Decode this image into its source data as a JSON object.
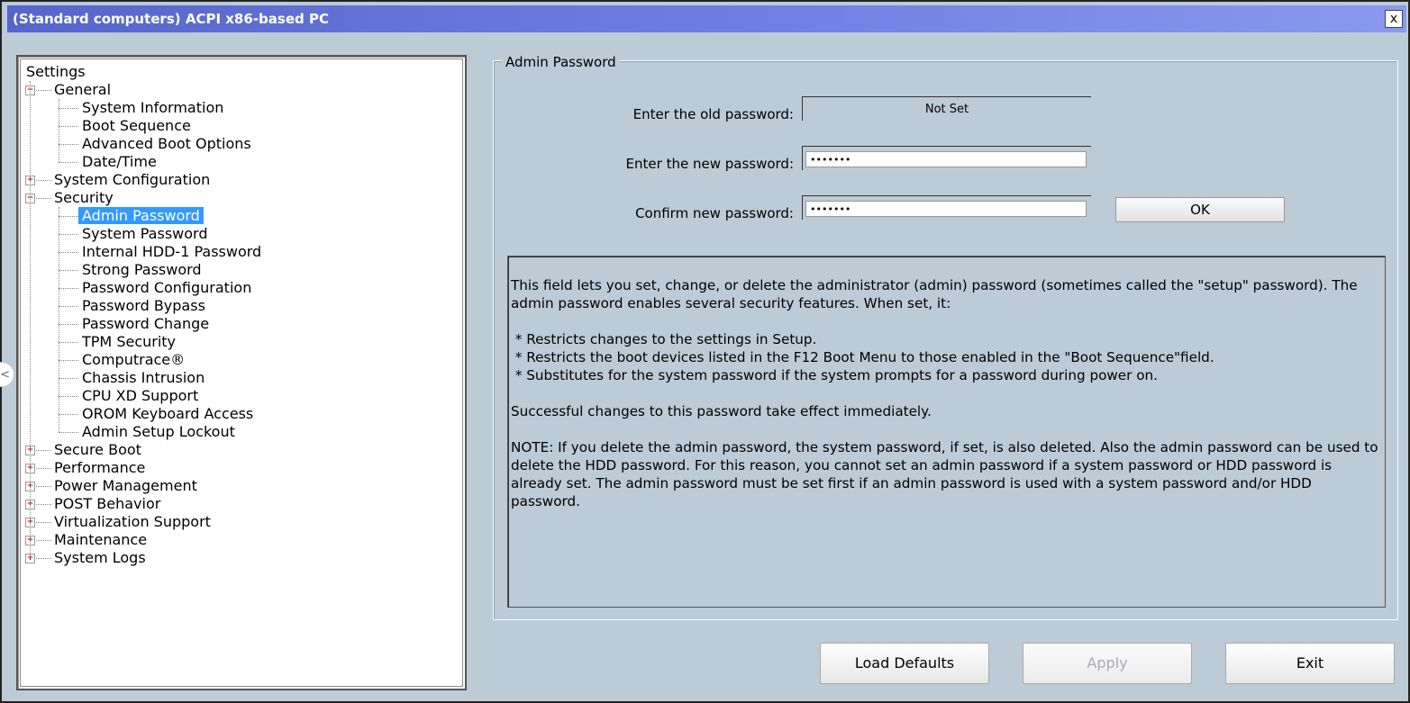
{
  "window": {
    "title": "(Standard computers) ACPI x86-based PC",
    "close_label": "x"
  },
  "tree": {
    "root": "Settings",
    "items": [
      {
        "label": "General",
        "level": 1,
        "expander": "−"
      },
      {
        "label": "System Information",
        "level": 2
      },
      {
        "label": "Boot Sequence",
        "level": 2
      },
      {
        "label": "Advanced Boot Options",
        "level": 2
      },
      {
        "label": "Date/Time",
        "level": 2
      },
      {
        "label": "System Configuration",
        "level": 1,
        "expander": "+"
      },
      {
        "label": "Security",
        "level": 1,
        "expander": "−"
      },
      {
        "label": "Admin Password",
        "level": 2,
        "selected": true
      },
      {
        "label": "System Password",
        "level": 2
      },
      {
        "label": "Internal HDD-1 Password",
        "level": 2
      },
      {
        "label": "Strong Password",
        "level": 2
      },
      {
        "label": "Password Configuration",
        "level": 2
      },
      {
        "label": "Password Bypass",
        "level": 2
      },
      {
        "label": "Password Change",
        "level": 2
      },
      {
        "label": "TPM Security",
        "level": 2
      },
      {
        "label": "Computrace®",
        "level": 2
      },
      {
        "label": "Chassis Intrusion",
        "level": 2
      },
      {
        "label": "CPU XD Support",
        "level": 2
      },
      {
        "label": "OROM Keyboard Access",
        "level": 2
      },
      {
        "label": "Admin Setup Lockout",
        "level": 2
      },
      {
        "label": "Secure Boot",
        "level": 1,
        "expander": "+"
      },
      {
        "label": "Performance",
        "level": 1,
        "expander": "+"
      },
      {
        "label": "Power Management",
        "level": 1,
        "expander": "+"
      },
      {
        "label": "POST Behavior",
        "level": 1,
        "expander": "+"
      },
      {
        "label": "Virtualization Support",
        "level": 1,
        "expander": "+"
      },
      {
        "label": "Maintenance",
        "level": 1,
        "expander": "+"
      },
      {
        "label": "System Logs",
        "level": 1,
        "expander": "+"
      }
    ]
  },
  "panel": {
    "group_title": "Admin Password",
    "old_password_label": "Enter the old password:",
    "old_password_value": "Not Set",
    "new_password_label": "Enter the new password:",
    "new_password_value": "•••••••",
    "confirm_password_label": "Confirm new password:",
    "confirm_password_value": "•••••••",
    "ok_label": "OK",
    "description": "This field lets you set, change, or delete the administrator (admin) password (sometimes called the \"setup\" password). The admin password enables several security features. When set, it:\n\n * Restricts changes to the settings in Setup.\n * Restricts the boot devices listed in the F12 Boot Menu to those enabled in the \"Boot Sequence\"field.\n * Substitutes for the system password if the system prompts for a password during power on.\n\nSuccessful changes to this password take effect immediately.\n\nNOTE: If you delete the admin password, the system password, if set, is also deleted. Also the admin password can be used to delete the HDD password. For this reason, you cannot set an admin password if a system password or HDD password is already set. The admin password must be set first if an admin password is used with a system password and/or HDD password."
  },
  "buttons": {
    "load_defaults": "Load Defaults",
    "apply": "Apply",
    "exit": "Exit"
  },
  "side_handle_icon": "chevron-left-icon"
}
